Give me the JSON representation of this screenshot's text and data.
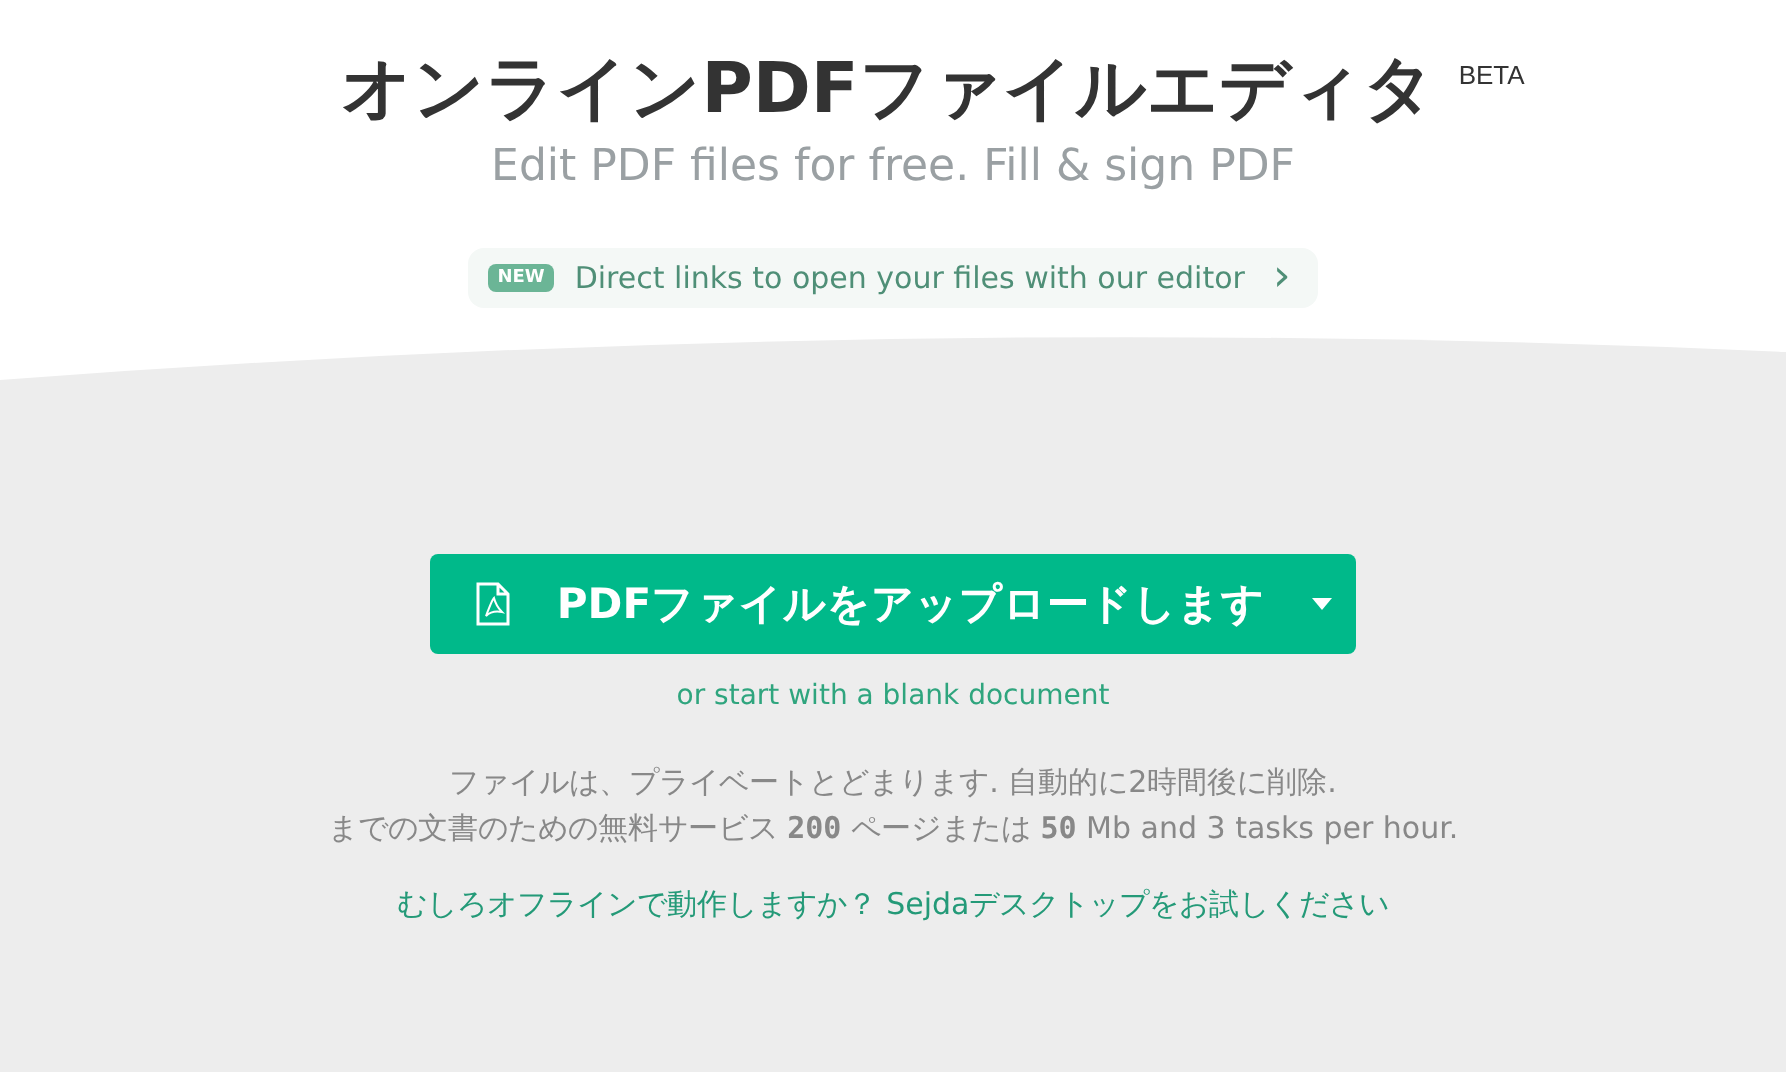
{
  "header": {
    "title": "オンラインPDFファイルエディタ",
    "badge": "BETA",
    "subtitle": "Edit PDF files for free. Fill & sign PDF"
  },
  "announcement": {
    "tag": "NEW",
    "text": "Direct links to open your files with our editor",
    "arrow": "›"
  },
  "upload": {
    "label": "PDFファイルをアップロードします",
    "alt_link": "or start with a blank document"
  },
  "info": [
    "ファイルは、プライベートとどまります. 自動的に2時間後に削除.",
    "までの文書のための無料サービス **200** ページまたは **50** Mb and 3 tasks per hour."
  ],
  "offline_link": "むしろオフラインで動作しますか？ Sejdaデスクトップをお試しください"
}
